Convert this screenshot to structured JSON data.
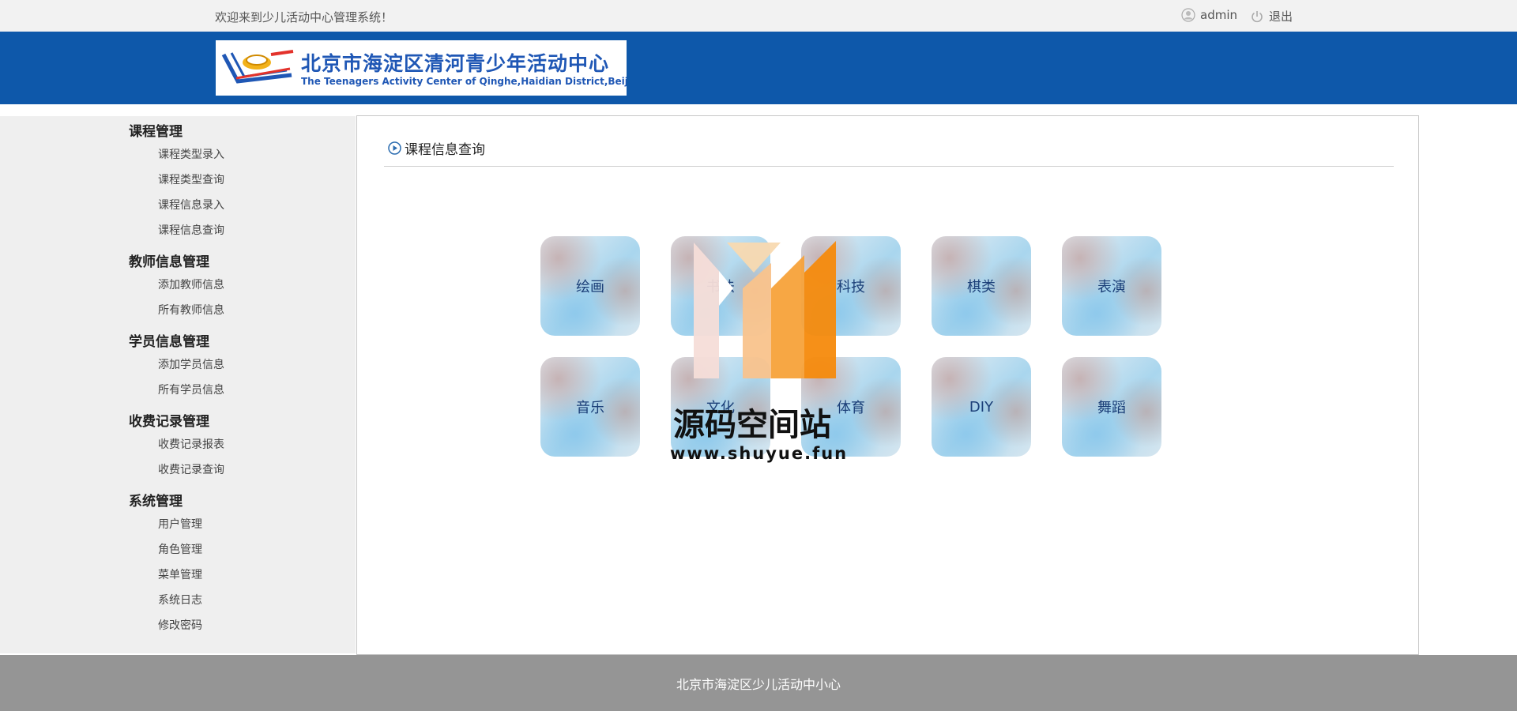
{
  "topbar": {
    "welcome": "欢迎来到少儿活动中心管理系统！",
    "username": "admin",
    "logout": "退出"
  },
  "header": {
    "logo_title": "北京市海淀区清河青少年活动中心",
    "logo_subtitle": "The Teenagers Activity Center of Qinghe,Haidian District,Beijing"
  },
  "sidebar": {
    "groups": [
      {
        "title": "课程管理",
        "items": [
          "课程类型录入",
          "课程类型查询",
          "课程信息录入",
          "课程信息查询"
        ]
      },
      {
        "title": "教师信息管理",
        "items": [
          "添加教师信息",
          "所有教师信息"
        ]
      },
      {
        "title": "学员信息管理",
        "items": [
          "添加学员信息",
          "所有学员信息"
        ]
      },
      {
        "title": "收费记录管理",
        "items": [
          "收费记录报表",
          "收费记录查询"
        ]
      },
      {
        "title": "系统管理",
        "items": [
          "用户管理",
          "角色管理",
          "菜单管理",
          "系统日志",
          "修改密码"
        ]
      }
    ]
  },
  "main": {
    "title": "课程信息查询",
    "categories": [
      "绘画",
      "书法",
      "科技",
      "棋类",
      "表演",
      "音乐",
      "文化",
      "体育",
      "DIY",
      "舞蹈"
    ]
  },
  "watermark": {
    "text": "源码空间站",
    "url": "www.shuyue.fun"
  },
  "footer": {
    "text": "北京市海淀区少儿活动中小心"
  },
  "colors": {
    "header_bg": "#0e58aa",
    "sidebar_bg": "#efefef",
    "footer_bg": "#959595",
    "tile_text": "#1b3f78",
    "watermark_orange": "#f7941d"
  },
  "icons": {
    "user": "user-icon",
    "logout": "power-icon",
    "title": "circle-play-icon"
  }
}
